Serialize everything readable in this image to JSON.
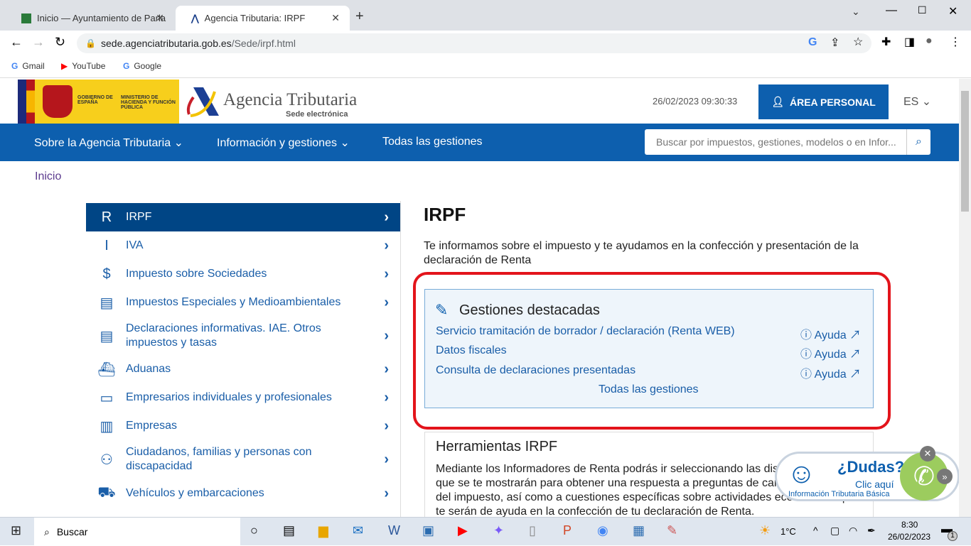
{
  "browser": {
    "tabs": [
      {
        "title": "Inicio — Ayuntamiento de Parla"
      },
      {
        "title": "Agencia Tributaria: IRPF"
      }
    ],
    "url_host": "sede.agenciatributaria.gob.es",
    "url_path": "/Sede/irpf.html",
    "bookmarks": [
      "Gmail",
      "YouTube",
      "Google"
    ]
  },
  "header": {
    "gov1": "GOBIERNO DE ESPAÑA",
    "gov2": "MINISTERIO DE HACIENDA Y FUNCIÓN PÚBLICA",
    "brand": "Agencia Tributaria",
    "brand_sub": "Sede electrónica",
    "datetime": "26/02/2023 09:30:33",
    "area_personal": "ÁREA PERSONAL",
    "lang": "ES"
  },
  "nav": {
    "items": [
      "Sobre la Agencia Tributaria",
      "Información y gestiones",
      "Todas las gestiones"
    ],
    "search_placeholder": "Buscar por impuestos, gestiones, modelos o en Infor..."
  },
  "breadcrumb": "Inicio",
  "sidebar": [
    {
      "label": "IRPF",
      "icon": "receipt-r-icon"
    },
    {
      "label": "IVA",
      "icon": "receipt-i-icon"
    },
    {
      "label": "Impuesto sobre Sociedades",
      "icon": "receipt-s-icon"
    },
    {
      "label": "Impuestos Especiales y Medioambientales",
      "icon": "clipboard-icon"
    },
    {
      "label": "Declaraciones informativas. IAE. Otros impuestos y tasas",
      "icon": "clipboard-list-icon"
    },
    {
      "label": "Aduanas",
      "icon": "ship-icon"
    },
    {
      "label": "Empresarios individuales y profesionales",
      "icon": "briefcase-icon"
    },
    {
      "label": "Empresas",
      "icon": "building-icon"
    },
    {
      "label": "Ciudadanos, familias y personas con discapacidad",
      "icon": "people-icon"
    },
    {
      "label": "Vehículos y embarcaciones",
      "icon": "truck-icon"
    }
  ],
  "main": {
    "title": "IRPF",
    "intro": "Te informamos sobre el impuesto y te ayudamos en la confección y presentación de la declaración de Renta",
    "gestiones": {
      "title": "Gestiones destacadas",
      "links": [
        "Servicio tramitación de borrador / declaración (Renta WEB)",
        "Datos fiscales",
        "Consulta de declaraciones presentadas"
      ],
      "help": "Ayuda",
      "all": "Todas las gestiones"
    },
    "herramientas": {
      "title": "Herramientas IRPF",
      "text": "Mediante los Informadores de Renta podrás ir seleccionando las distintas opciones que se te mostrarán para obtener una respuesta a preguntas de carácter general del impuesto, así como a cuestiones específicas sobre actividades económicas que te serán de ayuda en la confección de tu declaración de Renta."
    }
  },
  "dudas": {
    "title": "¿Dudas?",
    "cta": "Clic aquí",
    "sub": "Información Tributaria Básica"
  },
  "taskbar": {
    "search": "Buscar",
    "temp": "1°C",
    "time": "8:30",
    "date": "26/02/2023",
    "notifications": "1"
  },
  "colors": {
    "brand_blue": "#0d5fae",
    "active": "#004585",
    "highlight": "#e3141b"
  }
}
